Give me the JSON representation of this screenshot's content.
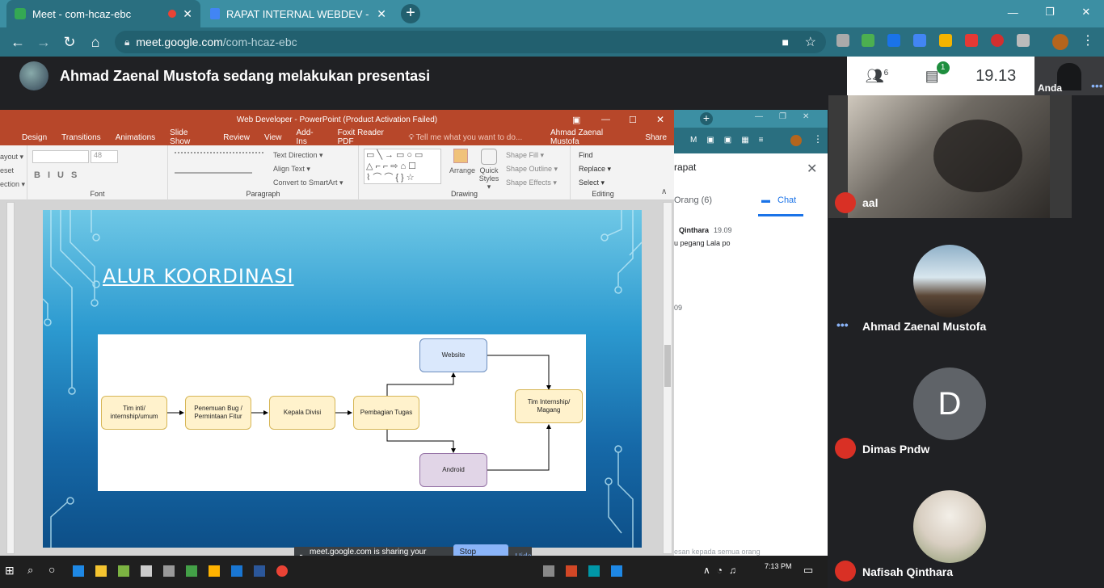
{
  "browser": {
    "tabs": [
      {
        "title": "Meet - com-hcaz-ebc",
        "active": true
      },
      {
        "title": "RAPAT INTERNAL WEBDEV - Goo",
        "active": false
      }
    ],
    "new_tab": "+",
    "url_domain": "meet.google.com",
    "url_path": "/com-hcaz-ebc",
    "window_controls": [
      "—",
      "❐",
      "✕"
    ]
  },
  "meet": {
    "presenter_text": "Ahmad Zaenal Mustofa sedang melakukan presentasi",
    "participant_count": "6",
    "chat_badge": "1",
    "time": "19.13",
    "self_label": "Anda",
    "participants": [
      {
        "name": "aal",
        "muted": true
      },
      {
        "name": "Ahmad Zaenal Mustofa",
        "muted": false
      },
      {
        "name": "Dimas Pndw",
        "muted": true,
        "initial": "D"
      },
      {
        "name": "Nafisah Qinthara",
        "muted": true
      }
    ],
    "share_notice": "meet.google.com is sharing your screen.",
    "stop_sharing": "Stop sharing",
    "hide": "Hide"
  },
  "powerpoint": {
    "title": "Web Developer - PowerPoint (Product Activation Failed)",
    "menu": [
      "Design",
      "Transitions",
      "Animations",
      "Slide Show",
      "Review",
      "View",
      "Add-Ins",
      "Foxit Reader PDF"
    ],
    "tellme": "Tell me what you want to do...",
    "user": "Ahmad Zaenal Mustofa",
    "share": "Share",
    "left_fragments": [
      "ayout ▾",
      "eset",
      "ection ▾"
    ],
    "font_size": "48",
    "groups": {
      "font": "Font",
      "paragraph": "Paragraph",
      "drawing": "Drawing",
      "editing": "Editing"
    },
    "para_items": [
      "Text Direction ▾",
      "Align Text ▾",
      "Convert to SmartArt ▾"
    ],
    "drawing_items": [
      "Arrange",
      "Quick Styles ▾",
      "Shape Fill ▾",
      "Shape Outline ▾",
      "Shape Effects ▾"
    ],
    "editing_items": [
      "Find",
      "Replace ▾",
      "Select ▾"
    ],
    "slide_title": "ALUR KOORDINASI",
    "nodes": {
      "n1": "Tim inti/ internship/umum",
      "n2": "Penemuan Bug / Permintaan Fitur",
      "n3": "Kepala Divisi",
      "n4": "Pembagian Tugas",
      "web": "Website",
      "android": "Android",
      "tim": "Tim Internship/ Magang"
    }
  },
  "chat": {
    "title": "rapat",
    "tab_people": "Orang (6)",
    "tab_chat": "Chat",
    "msg_sender": "Qinthara",
    "msg_time": "19.09",
    "msg_text": "u pegang Lala po",
    "time2": "09",
    "input_placeholder": "esan kepada semua orang"
  },
  "taskbar": {
    "time": "7:13 PM"
  }
}
